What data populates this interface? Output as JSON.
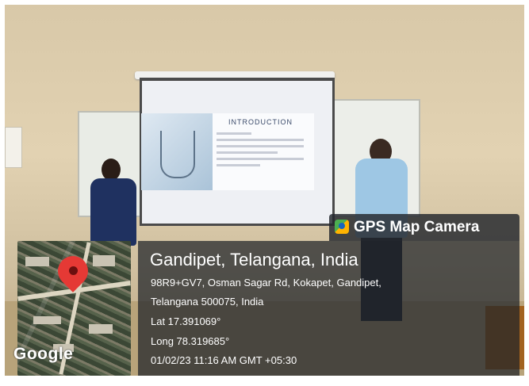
{
  "slide": {
    "title": "INTRODUCTION"
  },
  "map": {
    "provider_text": "Google"
  },
  "badge": {
    "label": "GPS Map Camera"
  },
  "location": {
    "place": "Gandipet, Telangana, India",
    "address_line1": "98R9+GV7, Osman Sagar Rd, Kokapet, Gandipet,",
    "address_line2": "Telangana 500075, India",
    "lat": "Lat 17.391069°",
    "long": "Long 78.319685°",
    "datetime": "01/02/23 11:16 AM GMT +05:30"
  },
  "colors": {
    "pin": "#e53935",
    "overlay": "#1e2228"
  }
}
